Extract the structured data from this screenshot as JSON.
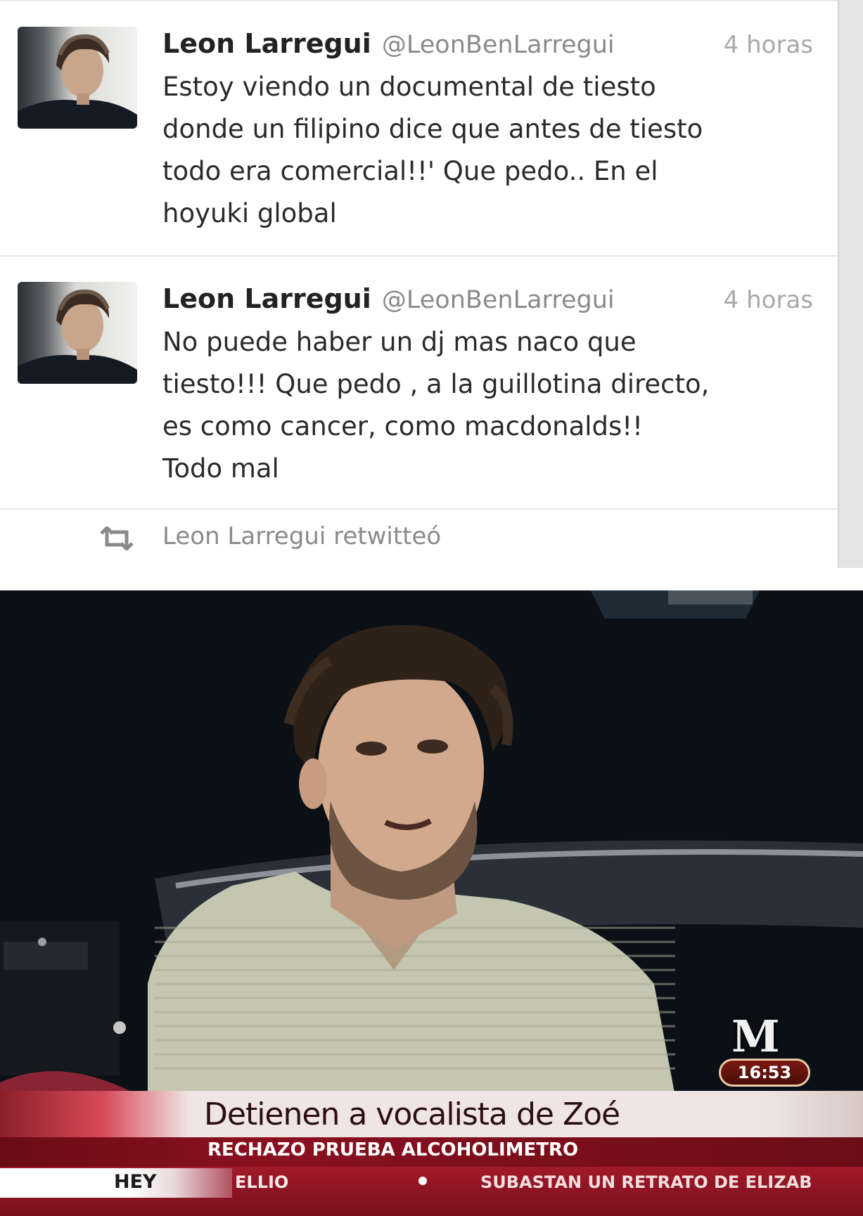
{
  "tweets": [
    {
      "author": "Leon Larregui",
      "handle": "@LeonBenLarregui",
      "time": "4 horas",
      "text": "Estoy viendo un documental de tiesto\ndonde un filipino dice que antes de tiesto\ntodo era comercial!!' Que pedo.. En el\nhoyuki global"
    },
    {
      "author": "Leon Larregui",
      "handle": "@LeonBenLarregui",
      "time": "4 horas",
      "text": "No puede haber un dj mas naco que\ntiesto!!! Que pedo , a la guillotina directo,\nes como cancer, como macdonalds!!\nTodo mal"
    }
  ],
  "retweet": {
    "label": "Leon Larregui retwitteó",
    "icon": "retweet-icon"
  },
  "tv": {
    "channel_logo": "M",
    "clock": "16:53",
    "headline": "Detienen a vocalista de Zoé",
    "subheadline": "RECHAZO PRUEBA ALCOHOLIMETRO",
    "ticker_brand": "HEY",
    "ticker_left": "ELLIO",
    "ticker_right": "SUBASTAN UN RETRATO DE ELIZAB"
  },
  "colors": {
    "author": "#222222",
    "muted": "#8a8a8a",
    "banner_red": "#8a1020"
  }
}
